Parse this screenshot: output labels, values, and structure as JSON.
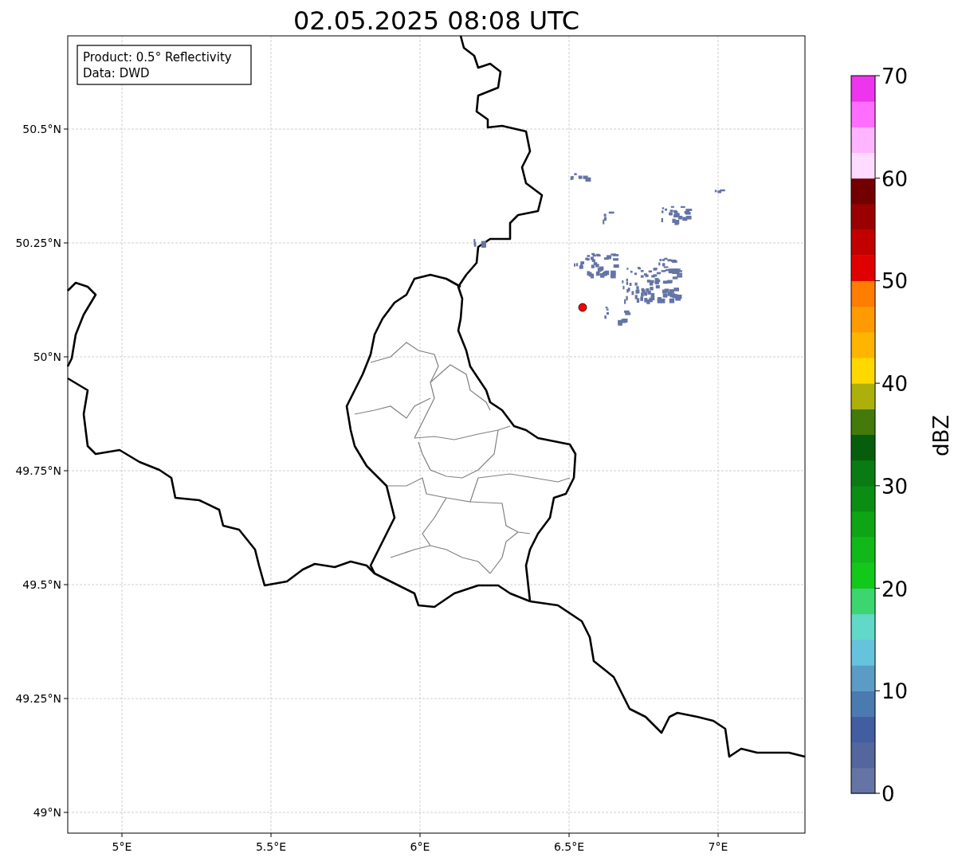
{
  "title": "02.05.2025 08:08 UTC",
  "info_box": {
    "lines": [
      "Product: 0.5° Reflectivity",
      "Data: DWD"
    ]
  },
  "map": {
    "lat_ticks": [
      "50.5°N",
      "50.25°N",
      "50°N",
      "49.75°N",
      "49.5°N",
      "49.25°N",
      "49°N"
    ],
    "lon_ticks": [
      "5°E",
      "5.5°E",
      "6°E",
      "6.5°E",
      "7°E"
    ]
  },
  "colorbar": {
    "label": "dBZ",
    "ticks": [
      "70",
      "60",
      "50",
      "40",
      "30",
      "20",
      "10",
      "0"
    ],
    "segments": [
      {
        "color": "#6475a5"
      },
      {
        "color": "#53679e"
      },
      {
        "color": "#425ea0"
      },
      {
        "color": "#4a7ab0"
      },
      {
        "color": "#5a9cc5"
      },
      {
        "color": "#66c3dd"
      },
      {
        "color": "#62d8c8"
      },
      {
        "color": "#3dd570"
      },
      {
        "color": "#12c81a"
      },
      {
        "color": "#10b81a"
      },
      {
        "color": "#0ea514"
      },
      {
        "color": "#0b8d14"
      },
      {
        "color": "#0a7a12"
      },
      {
        "color": "#065e0c"
      },
      {
        "color": "#437a0a"
      },
      {
        "color": "#adb00a"
      },
      {
        "color": "#ffd800"
      },
      {
        "color": "#ffb400"
      },
      {
        "color": "#ff9a00"
      },
      {
        "color": "#ff7d00"
      },
      {
        "color": "#e00000"
      },
      {
        "color": "#c20000"
      },
      {
        "color": "#9a0000"
      },
      {
        "color": "#730000"
      },
      {
        "color": "#ffdcff"
      },
      {
        "color": "#ffb4ff"
      },
      {
        "color": "#ff6eff"
      },
      {
        "color": "#ec35ec"
      }
    ]
  }
}
